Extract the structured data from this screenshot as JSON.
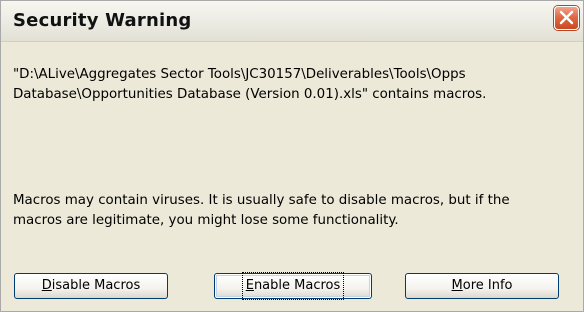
{
  "dialog": {
    "title": "Security Warning",
    "close_icon": "close-icon",
    "message_path": "\"D:\\ALive\\Aggregates Sector Tools\\JC30157\\Deliverables\\Tools\\Opps\nDatabase\\Opportunities Database (Version 0.01).xls\" contains macros.",
    "message_warning": "Macros may contain viruses. It is usually safe to disable macros, but if the\nmacros are legitimate, you might lose some functionality."
  },
  "buttons": {
    "disable": {
      "mnemonic": "D",
      "rest": "isable Macros"
    },
    "enable": {
      "mnemonic": "E",
      "rest": "nable Macros"
    },
    "more_info": {
      "prefix": "",
      "mnemonic": "M",
      "rest": "ore Info"
    }
  },
  "colors": {
    "background": "#ece9d8",
    "close_button": "#e06a45",
    "button_border": "#003c74"
  }
}
